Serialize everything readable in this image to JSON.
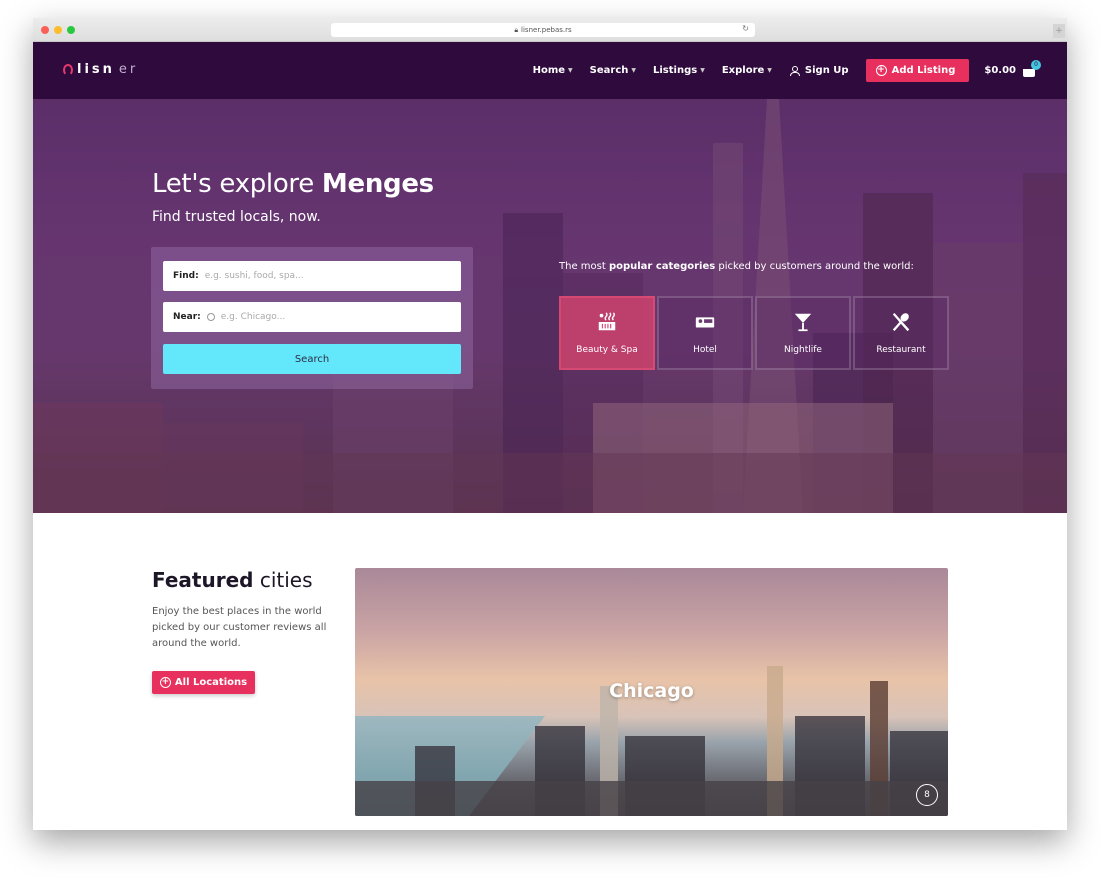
{
  "browser": {
    "url": "lisner.pebas.rs",
    "lock_icon": "lock-icon",
    "reload_icon": "reload-icon",
    "new_tab_label": "+"
  },
  "colors": {
    "navbar_bg": "#2f0a3d",
    "accent": "#e8305e",
    "search_button": "#63e8fb",
    "cart_badge": "#43c6e0"
  },
  "navbar": {
    "logo_main": "lisn",
    "logo_end": "er",
    "items": [
      {
        "label": "Home",
        "has_dropdown": true
      },
      {
        "label": "Search",
        "has_dropdown": true
      },
      {
        "label": "Listings",
        "has_dropdown": true
      },
      {
        "label": "Explore",
        "has_dropdown": true
      }
    ],
    "signup_label": "Sign Up",
    "add_listing_label": "Add Listing",
    "cart_total": "$0.00",
    "cart_count": "0"
  },
  "hero": {
    "title_prefix": "Let's explore ",
    "title_bold": "Menges",
    "subtitle": "Find trusted locals, now.",
    "search": {
      "find_label": "Find:",
      "find_placeholder": "e.g. sushi, food, spa...",
      "near_label": "Near:",
      "near_placeholder": "e.g. Chicago...",
      "button_label": "Search"
    },
    "popular_prefix": "The most ",
    "popular_bold": "popular categories",
    "popular_suffix": " picked by customers around the world:",
    "categories": [
      {
        "label": "Beauty & Spa",
        "icon": "spa-icon",
        "active": true
      },
      {
        "label": "Hotel",
        "icon": "bed-icon",
        "active": false
      },
      {
        "label": "Nightlife",
        "icon": "cocktail-icon",
        "active": false
      },
      {
        "label": "Restaurant",
        "icon": "utensils-icon",
        "active": false
      }
    ]
  },
  "featured": {
    "title_bold": "Featured",
    "title_rest": " cities",
    "description": "Enjoy the best places in the world picked by our customer reviews all around the world.",
    "button_label": "All Locations",
    "city": {
      "name": "Chicago",
      "count": "8"
    }
  }
}
